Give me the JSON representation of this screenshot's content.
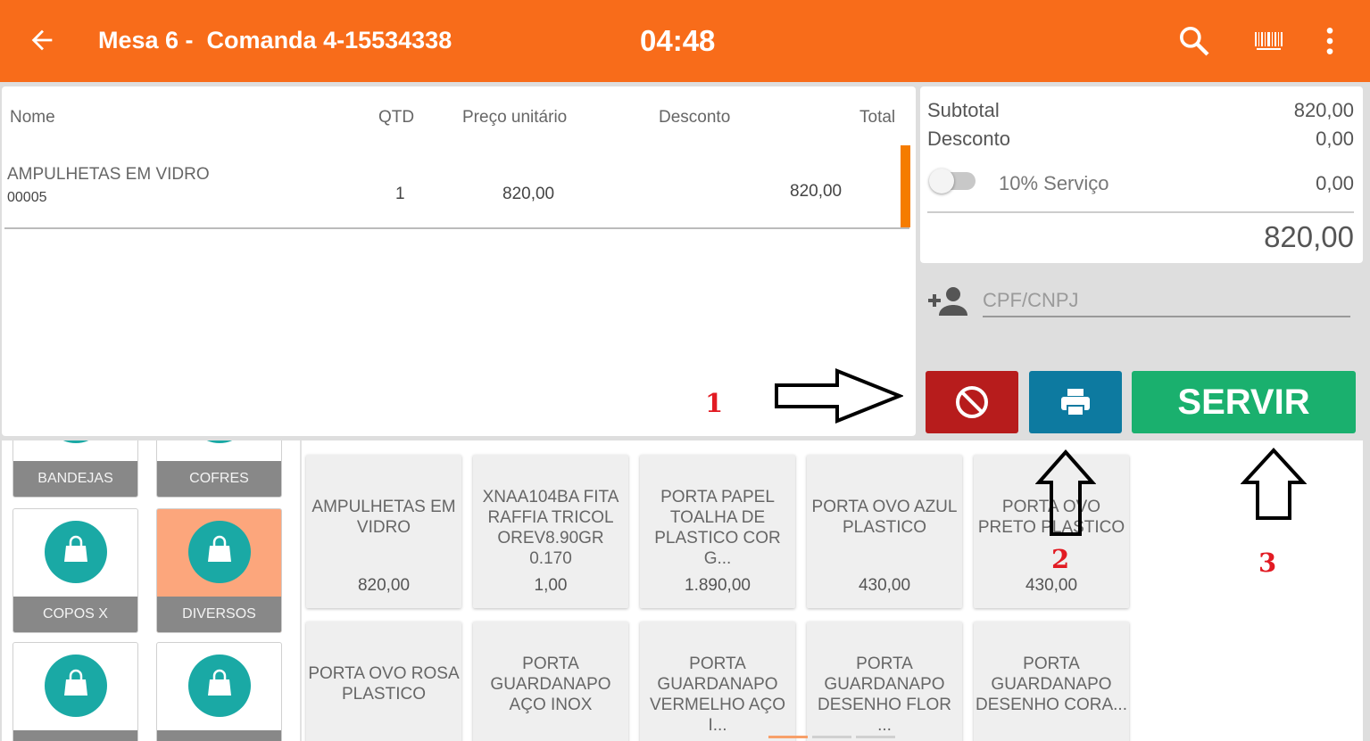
{
  "header": {
    "title": "Mesa 6 -  Comanda 4-15534338",
    "time": "04:48",
    "icons": [
      "back-arrow-icon",
      "search-icon",
      "barcode-icon",
      "more-vert-icon"
    ],
    "color": "#f86c1a"
  },
  "order": {
    "columns": [
      "Nome",
      "QTD",
      "Preço unitário",
      "Desconto",
      "Total"
    ],
    "items": [
      {
        "name": "AMPULHETAS EM VIDRO",
        "code": "00005",
        "qty": "1",
        "unit_price": "820,00",
        "discount": "",
        "total": "820,00"
      }
    ]
  },
  "totals": {
    "subtotal_label": "Subtotal",
    "subtotal_value": "820,00",
    "discount_label": "Desconto",
    "discount_value": "0,00",
    "service_label": "10% Serviço",
    "service_value": "0,00",
    "service_enabled": false,
    "grand_total": "820,00"
  },
  "customer": {
    "placeholder": "CPF/CNPJ",
    "icon": "add-person-icon"
  },
  "actions": {
    "cancel_icon": "block-icon",
    "print_icon": "print-icon",
    "serve_label": "SERVIR",
    "colors": {
      "cancel": "#b71c1c",
      "print": "#0d7aa0",
      "serve": "#1ab06e"
    }
  },
  "annotations": {
    "n1": "1",
    "n2": "2",
    "n3": "3"
  },
  "categories": [
    {
      "label": "BANDEJAS",
      "active": false
    },
    {
      "label": "COFRES",
      "active": false
    },
    {
      "label": "COPOS X",
      "active": false
    },
    {
      "label": "DIVERSOS",
      "active": true
    },
    {
      "label": "",
      "active": false
    },
    {
      "label": "",
      "active": false
    }
  ],
  "products": [
    {
      "name": "AMPULHETAS EM VIDRO",
      "price": "820,00"
    },
    {
      "name": "XNAA104BA FITA RAFFIA TRICOL OREV8.90GR 0.170",
      "price": "1,00"
    },
    {
      "name": "PORTA PAPEL TOALHA DE PLASTICO COR G...",
      "price": "1.890,00"
    },
    {
      "name": "PORTA OVO AZUL PLASTICO",
      "price": "430,00"
    },
    {
      "name": "PORTA OVO PRETO PLASTICO",
      "price": "430,00"
    },
    {
      "name": "PORTA OVO ROSA PLASTICO",
      "price": ""
    },
    {
      "name": "PORTA GUARDANAPO AÇO INOX",
      "price": ""
    },
    {
      "name": "PORTA GUARDANAPO VERMELHO AÇO I...",
      "price": ""
    },
    {
      "name": "PORTA GUARDANAPO DESENHO FLOR ...",
      "price": ""
    },
    {
      "name": "PORTA GUARDANAPO DESENHO CORA...",
      "price": ""
    }
  ]
}
